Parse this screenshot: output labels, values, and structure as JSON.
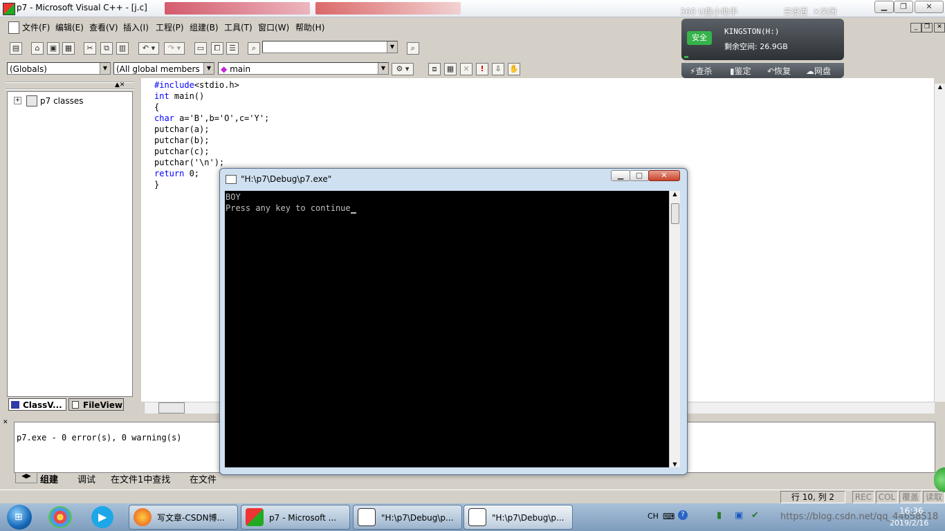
{
  "titlebar": {
    "title": "p7 - Microsoft Visual C++ - [j.c]",
    "helper_name": "360 U盘小助手",
    "settings": "设置",
    "close": "关闭"
  },
  "menu": [
    "文件(F)",
    "编辑(E)",
    "查看(V)",
    "插入(I)",
    "工程(P)",
    "组建(B)",
    "工具(T)",
    "窗口(W)",
    "帮助(H)"
  ],
  "wizardbar": {
    "class": "(Globals)",
    "members": "(All global members",
    "function": "main"
  },
  "classview": {
    "root": "p7 classes",
    "tab_classview": "ClassV...",
    "tab_fileview": "FileView"
  },
  "code_lines": [
    {
      "kw": "#include",
      "rest": "<stdio.h>"
    },
    {
      "kw": "int",
      "rest": " main()"
    },
    {
      "kw": "",
      "rest": "{"
    },
    {
      "kw": "char",
      "rest": " a='B',b='O',c='Y';"
    },
    {
      "kw": "",
      "rest": "putchar(a);"
    },
    {
      "kw": "",
      "rest": "putchar(b);"
    },
    {
      "kw": "",
      "rest": "putchar(c);"
    },
    {
      "kw": "",
      "rest": "putchar('\\n');"
    },
    {
      "kw": "return",
      "rest": " 0;"
    },
    {
      "kw": "",
      "rest": "}"
    }
  ],
  "console": {
    "title": "\"H:\\p7\\Debug\\p7.exe\"",
    "line1": "BOY",
    "line2": "Press any key to continue"
  },
  "output": {
    "text": "p7.exe - 0 error(s), 0 warning(s)",
    "tabs": [
      "组建",
      "调试",
      "在文件1中查找",
      "在文件"
    ]
  },
  "usb": {
    "badge": "安全",
    "drive": "KINGSTON(H:)",
    "space": "剩余空间: 26.9GB",
    "actions": [
      "查杀",
      "鉴定",
      "恢复",
      "网盘"
    ]
  },
  "status": {
    "position": "行 10, 列 2",
    "rec": "REC",
    "col": "COL",
    "ovr": "覆盖",
    "read": "读取"
  },
  "taskbar": {
    "buttons": [
      "写文章-CSDN博...",
      "p7 - Microsoft ...",
      "\"H:\\p7\\Debug\\p...",
      "\"H:\\p7\\Debug\\p..."
    ],
    "lang": "CH",
    "time": "16:36",
    "date": "2019/2/16",
    "watermark": "https://blog.csdn.net/qq_44658518"
  },
  "colors": {
    "keyword": "#0000ff",
    "console_bg": "#000000",
    "console_text": "#c0c0c0",
    "ide_bg": "#d4d0c8"
  }
}
